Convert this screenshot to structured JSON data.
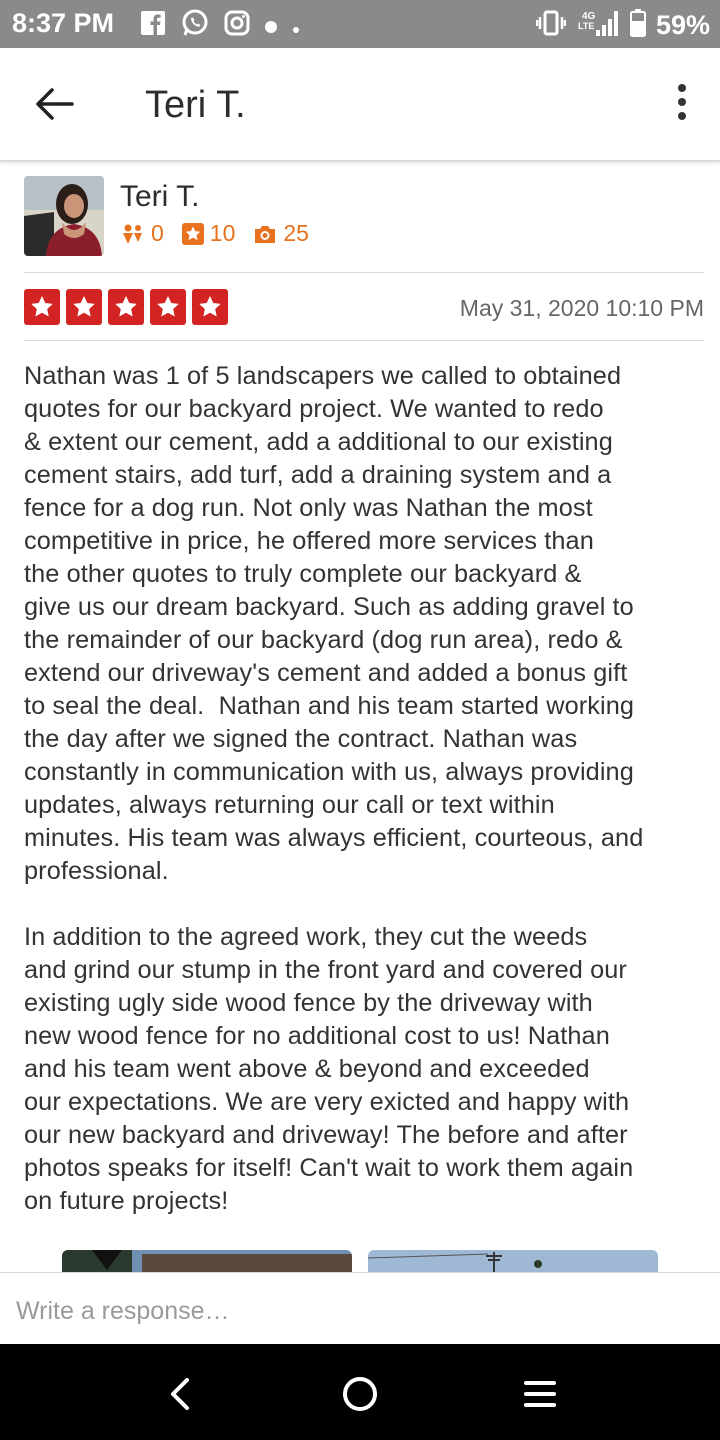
{
  "status_bar": {
    "time": "8:37 PM",
    "left_icons": [
      "facebook-icon",
      "whatsapp-icon",
      "instagram-icon",
      "dot-icon",
      "small-dot-icon"
    ],
    "network": "4G LTE",
    "battery": "59%"
  },
  "app_bar": {
    "title": "Teri T."
  },
  "reviewer": {
    "name": "Teri T.",
    "friends": "0",
    "reviews": "10",
    "photos": "25"
  },
  "review": {
    "rating": 5,
    "date": "May 31, 2020 10:10 PM",
    "text": "Nathan was 1 of 5 landscapers we called to obtained\nquotes for our backyard project. We wanted to redo\n& extent our cement, add a additional to our existing\ncement stairs, add turf, add a draining system and a\nfence for a dog run. Not only was Nathan the most\ncompetitive in price, he offered more services than\nthe other quotes to truly complete our backyard &\ngive us our dream backyard. Such as adding gravel to\nthe remainder of our backyard (dog run area), redo &\nextend our driveway's cement and added a bonus gift\nto seal the deal.  Nathan and his team started working\nthe day after we signed the contract. Nathan was\nconstantly in communication with us, always providing\nupdates, always returning our call or text within\nminutes. His team was always efficient, courteous, and\nprofessional.\n\nIn addition to the agreed work, they cut the weeds\nand grind our stump in the front yard and covered our\nexisting ugly side wood fence by the driveway with\nnew wood fence for no additional cost to us! Nathan\nand his team went above & beyond and exceeded\nour expectations. We are very exicted and happy with\nour new backyard and driveway! The before and after\nphotos speaks for itself! Can't wait to work them again\non future projects!"
  },
  "response": {
    "placeholder": "Write a response…"
  },
  "colors": {
    "star_red": "#d32323",
    "stat_orange": "#e8721d",
    "status_bar_gray": "#8a8a8a"
  }
}
